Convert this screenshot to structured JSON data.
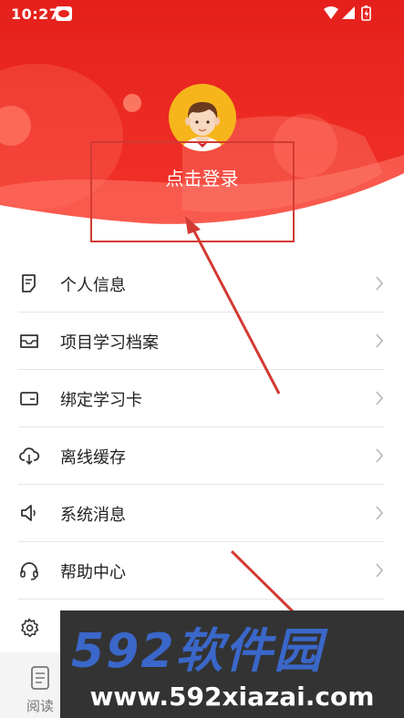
{
  "status_bar": {
    "time": "10:27",
    "app_icon": "app-logo-icon",
    "icons": [
      "wifi-icon",
      "signal-icon",
      "battery-charging-icon"
    ]
  },
  "profile": {
    "avatar_icon": "user-avatar-icon",
    "login_label": "点击登录"
  },
  "menu": {
    "items": [
      {
        "label": "个人信息",
        "icon": "note-icon"
      },
      {
        "label": "项目学习档案",
        "icon": "inbox-icon"
      },
      {
        "label": "绑定学习卡",
        "icon": "card-icon"
      },
      {
        "label": "离线缓存",
        "icon": "cloud-download-icon"
      },
      {
        "label": "系统消息",
        "icon": "speaker-icon"
      },
      {
        "label": "帮助中心",
        "icon": "headset-icon"
      },
      {
        "label": "",
        "icon": "gear-icon"
      }
    ]
  },
  "bottom_nav": {
    "read_label": "阅读",
    "read_icon": "book-icon"
  },
  "watermark": {
    "brand": "592软件园",
    "url": "www.592xiazai.com"
  },
  "colors": {
    "header_red": "#e9231f",
    "header_light": "#ff5a4a",
    "annotation_red": "#d23a33",
    "avatar_bg": "#f6b61b",
    "watermark_blue": "#3a67c9",
    "watermark_bg": "#333333"
  }
}
